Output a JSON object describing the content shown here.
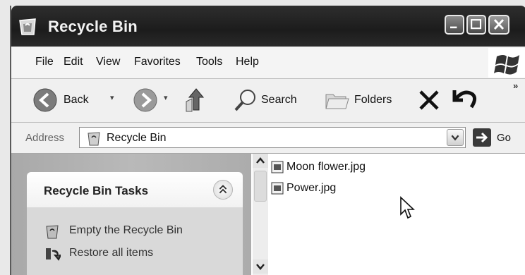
{
  "window": {
    "title": "Recycle Bin"
  },
  "menu": [
    "File",
    "Edit",
    "View",
    "Favorites",
    "Tools",
    "Help"
  ],
  "toolbar": {
    "back": "Back",
    "search": "Search",
    "folders": "Folders",
    "more": "»"
  },
  "address": {
    "label": "Address",
    "value": "Recycle Bin",
    "go": "Go"
  },
  "tasks": {
    "title": "Recycle Bin Tasks",
    "items": [
      {
        "label": "Empty the Recycle Bin",
        "icon": "empty-recycle-bin-icon"
      },
      {
        "label": "Restore all items",
        "icon": "restore-icon"
      }
    ]
  },
  "files": [
    {
      "name": "Moon flower.jpg",
      "icon": "jpg-file-icon"
    },
    {
      "name": "Power.jpg",
      "icon": "jpg-file-icon"
    }
  ],
  "colors": {
    "titlebar": "#222222",
    "task_pane": "#b0b0b0",
    "file_pane": "#ffffff"
  }
}
